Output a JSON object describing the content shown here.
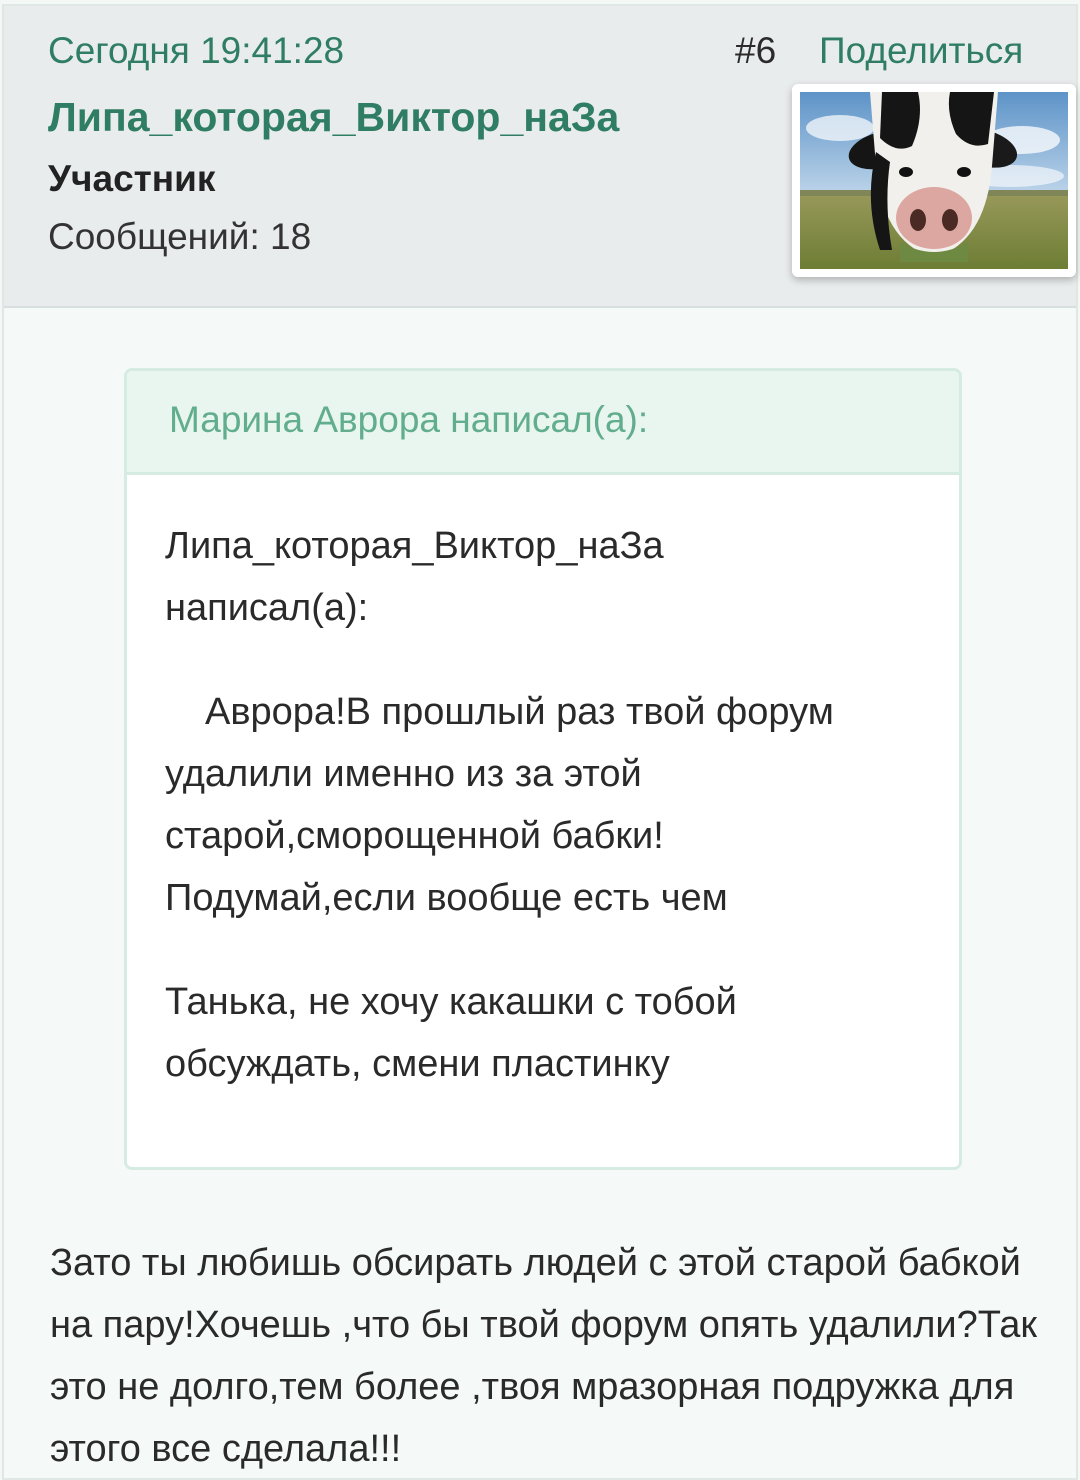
{
  "post": {
    "timestamp": "Сегодня 19:41:28",
    "number": "#6",
    "share_label": "Поделиться",
    "author": {
      "username": "Липа_которая_Виктор_наЗа",
      "role": "Участник",
      "posts_count": "Сообщений: 18",
      "avatar_icon": "cow-avatar-image"
    },
    "quote": {
      "author_label": "Марина Аврора написал(а):",
      "nested_author_line1": "Липа_которая_Виктор_наЗа",
      "nested_author_line2": "написал(а):",
      "nested_text": "Аврора!В прошлый раз твой форум удалили именно из за этой старой,сморощенной бабки! Подумай,если вообще есть чем",
      "reply_text": "Танька, не хочу какашки с тобой обсуждать, смени пластинку"
    },
    "reply_text": "Зато ты любишь обсирать людей с этой старой бабкой на пару!Хочешь ,что бы твой форум опять удалили?Так это не долго,тем более ,твоя мразорная подружка для этого все сделала!!!"
  },
  "colors": {
    "accent_green": "#2f7e63",
    "quote_author_green": "#62ad8d",
    "header_bg": "#e9ecec",
    "quote_head_bg": "#e8f6ef"
  }
}
